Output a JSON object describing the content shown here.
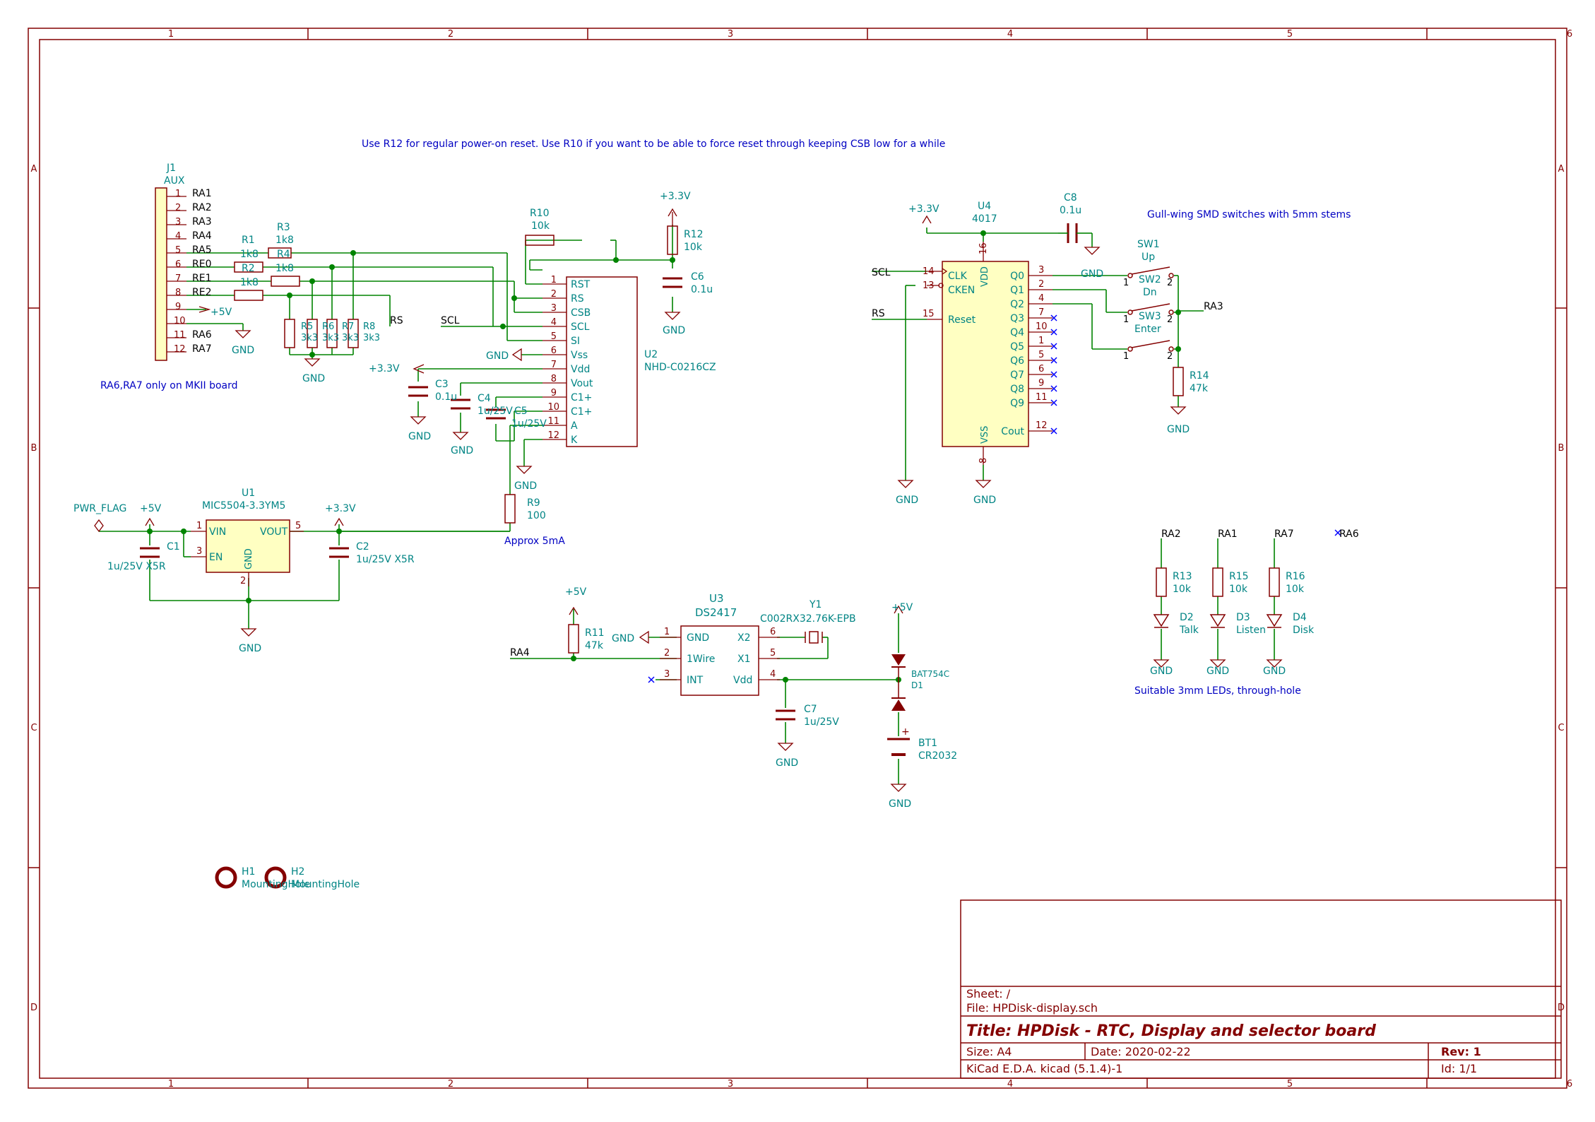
{
  "frame": {
    "col_labels": [
      "1",
      "2",
      "3",
      "4",
      "5",
      "6"
    ],
    "row_labels": [
      "A",
      "B",
      "C",
      "D"
    ]
  },
  "notes": {
    "reset_note": "Use R12 for regular power-on reset. Use R10 if you want to be able to force reset through keeping CSB low for a while",
    "ra_note": "RA6,RA7 only on MKII board",
    "switch_note": "Gull-wing SMD switches with 5mm stems",
    "led_note": "Suitable 3mm LEDs, through-hole",
    "current_note": "Approx 5mA"
  },
  "j1": {
    "ref": "J1",
    "value": "AUX",
    "pins": [
      {
        "num": "1",
        "net": "RA1"
      },
      {
        "num": "2",
        "net": "RA2"
      },
      {
        "num": "3",
        "net": "RA3"
      },
      {
        "num": "4",
        "net": "RA4"
      },
      {
        "num": "5",
        "net": "RA5"
      },
      {
        "num": "6",
        "net": "RE0"
      },
      {
        "num": "7",
        "net": "RE1"
      },
      {
        "num": "8",
        "net": "RE2"
      },
      {
        "num": "9",
        "net": "+5V"
      },
      {
        "num": "10",
        "net": "GND"
      },
      {
        "num": "11",
        "net": "RA6"
      },
      {
        "num": "12",
        "net": "RA7"
      }
    ]
  },
  "resistors": {
    "r1": {
      "ref": "R1",
      "value": "1k8"
    },
    "r2": {
      "ref": "R2",
      "value": "1k8"
    },
    "r3": {
      "ref": "R3",
      "value": "1k8"
    },
    "r4": {
      "ref": "R4",
      "value": "1k8"
    },
    "r5": {
      "ref": "R5",
      "value": "3k3"
    },
    "r6": {
      "ref": "R6",
      "value": "3k3"
    },
    "r7": {
      "ref": "R7",
      "value": "3k3"
    },
    "r8": {
      "ref": "R8",
      "value": "3k3"
    },
    "r9": {
      "ref": "R9",
      "value": "100"
    },
    "r10": {
      "ref": "R10",
      "value": "10k"
    },
    "r11": {
      "ref": "R11",
      "value": "47k"
    },
    "r12": {
      "ref": "R12",
      "value": "10k"
    },
    "r13": {
      "ref": "R13",
      "value": "10k"
    },
    "r14": {
      "ref": "R14",
      "value": "47k"
    },
    "r15": {
      "ref": "R15",
      "value": "10k"
    },
    "r16": {
      "ref": "R16",
      "value": "10k"
    }
  },
  "capacitors": {
    "c1": {
      "ref": "C1",
      "value": "1u/25V X5R"
    },
    "c2": {
      "ref": "C2",
      "value": "1u/25V X5R"
    },
    "c3": {
      "ref": "C3",
      "value": "0.1u"
    },
    "c4": {
      "ref": "C4",
      "value": "1u/25V"
    },
    "c5": {
      "ref": "C5",
      "value": "1u/25V"
    },
    "c6": {
      "ref": "C6",
      "value": "0.1u"
    },
    "c7": {
      "ref": "C7",
      "value": "1u/25V"
    },
    "c8": {
      "ref": "C8",
      "value": "0.1u"
    }
  },
  "u2": {
    "ref": "U2",
    "value": "NHD-C0216CZ",
    "pins": [
      {
        "num": "1",
        "name": "RST"
      },
      {
        "num": "2",
        "name": "RS"
      },
      {
        "num": "3",
        "name": "CSB"
      },
      {
        "num": "4",
        "name": "SCL"
      },
      {
        "num": "5",
        "name": "SI"
      },
      {
        "num": "6",
        "name": "Vss"
      },
      {
        "num": "7",
        "name": "Vdd"
      },
      {
        "num": "8",
        "name": "Vout"
      },
      {
        "num": "9",
        "name": "C1+"
      },
      {
        "num": "10",
        "name": "C1+"
      },
      {
        "num": "11",
        "name": "A"
      },
      {
        "num": "12",
        "name": "K"
      }
    ]
  },
  "u1": {
    "ref": "U1",
    "value": "MIC5504-3.3YM5",
    "vin": "VIN",
    "en": "EN",
    "vout": "VOUT",
    "gnd": "GND",
    "pin_vin": "1",
    "pin_en": "3",
    "pin_vout": "5",
    "pin_gnd": "2"
  },
  "u3": {
    "ref": "U3",
    "value": "DS2417",
    "left_pins": [
      {
        "num": "1",
        "name": "GND"
      },
      {
        "num": "2",
        "name": "1Wire"
      },
      {
        "num": "3",
        "name": "INT"
      }
    ],
    "right_pins": [
      {
        "num": "6",
        "name": "X2"
      },
      {
        "num": "5",
        "name": "X1"
      },
      {
        "num": "4",
        "name": "Vdd"
      }
    ]
  },
  "u4": {
    "ref": "U4",
    "value": "4017",
    "left_pins": [
      {
        "num": "14",
        "name": "CLK"
      },
      {
        "num": "13",
        "name": "CKEN"
      },
      {
        "num": "15",
        "name": "Reset"
      }
    ],
    "right_pins": [
      {
        "num": "3",
        "name": "Q0"
      },
      {
        "num": "2",
        "name": "Q1"
      },
      {
        "num": "4",
        "name": "Q2"
      },
      {
        "num": "7",
        "name": "Q3"
      },
      {
        "num": "10",
        "name": "Q4"
      },
      {
        "num": "1",
        "name": "Q5"
      },
      {
        "num": "5",
        "name": "Q6"
      },
      {
        "num": "6",
        "name": "Q7"
      },
      {
        "num": "9",
        "name": "Q8"
      },
      {
        "num": "11",
        "name": "Q9"
      },
      {
        "num": "12",
        "name": "Cout"
      }
    ],
    "vdd": "VDD",
    "vss": "VSS",
    "pin_vdd": "16",
    "pin_vss": "8"
  },
  "y1": {
    "ref": "Y1",
    "value": "C002RX32.76K-EPB"
  },
  "d1": {
    "ref": "D1",
    "value": "BAT754C"
  },
  "bt1": {
    "ref": "BT1",
    "value": "CR2032"
  },
  "switches": [
    {
      "ref": "SW1",
      "value": "Up"
    },
    {
      "ref": "SW2",
      "value": "Dn"
    },
    {
      "ref": "SW3",
      "value": "Enter"
    }
  ],
  "leds": [
    {
      "ref": "D2",
      "value": "Talk",
      "net": "RA2"
    },
    {
      "ref": "D3",
      "value": "Listen",
      "net": "RA1"
    },
    {
      "ref": "D4",
      "value": "Disk",
      "net": "RA7"
    }
  ],
  "mounting": [
    {
      "ref": "H1",
      "value": "MountingHole"
    },
    {
      "ref": "H2",
      "value": "MountingHole"
    }
  ],
  "nets": {
    "gnd": "GND",
    "p5v": "+5V",
    "p33v": "+3.3V",
    "scl": "SCL",
    "rs": "RS",
    "ra3": "RA3",
    "ra4": "RA4",
    "ra6": "RA6",
    "pwr_flag": "PWR_FLAG",
    "pin1": "1",
    "pin2": "2"
  },
  "title_block": {
    "sheet": "Sheet: /",
    "file": "File: HPDisk-display.sch",
    "title": "Title: HPDisk - RTC, Display and selector board",
    "size": "Size: A4",
    "date": "Date: 2020-02-22",
    "rev": "Rev: 1",
    "tool": "KiCad E.D.A.  kicad (5.1.4)-1",
    "id": "Id: 1/1"
  },
  "colors": {
    "frame": "#840000",
    "wire": "#008400",
    "component": "#840000",
    "pin": "#840000",
    "label": "#008484",
    "note": "#0000c2",
    "body_fill": "#ffffc2",
    "no_connect": "#0000ff"
  }
}
